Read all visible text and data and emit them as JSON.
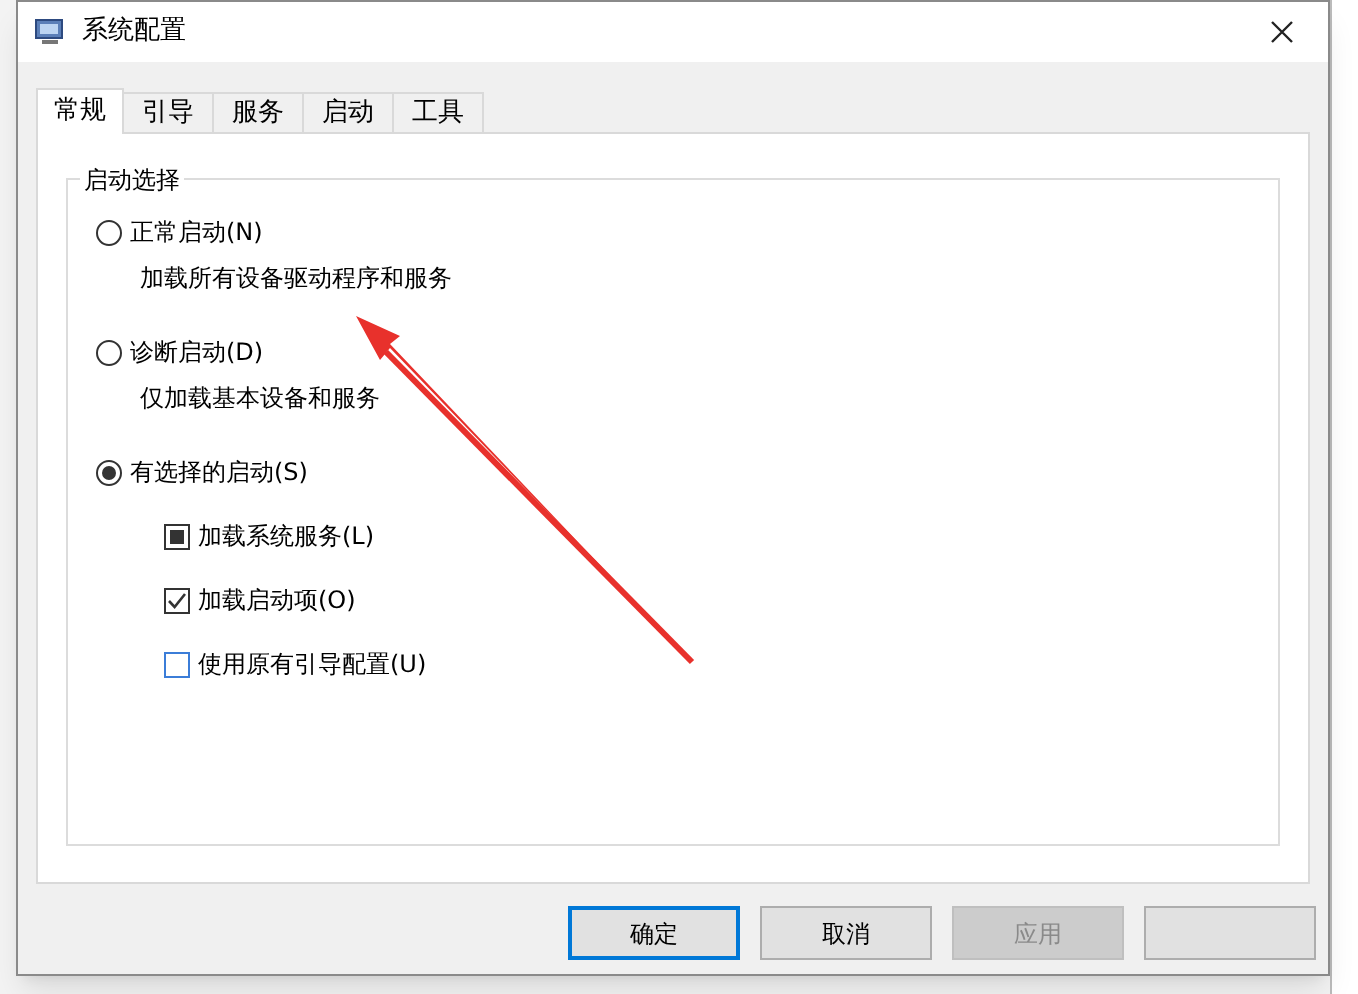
{
  "window": {
    "title": "系统配置"
  },
  "tabs": [
    {
      "label": "常规",
      "selected": true
    },
    {
      "label": "引导",
      "selected": false
    },
    {
      "label": "服务",
      "selected": false
    },
    {
      "label": "启动",
      "selected": false
    },
    {
      "label": "工具",
      "selected": false
    }
  ],
  "startup_group": {
    "legend": "启动选择",
    "options": [
      {
        "label": "正常启动(N)",
        "description": "加载所有设备驱动程序和服务",
        "selected": false
      },
      {
        "label": "诊断启动(D)",
        "description": "仅加载基本设备和服务",
        "selected": false
      },
      {
        "label": "有选择的启动(S)",
        "selected": true,
        "checkboxes": [
          {
            "label": "加载系统服务(L)",
            "checked": false,
            "indeterminate": true
          },
          {
            "label": "加载启动项(O)",
            "checked": true,
            "indeterminate": false
          },
          {
            "label": "使用原有引导配置(U)",
            "checked": false,
            "indeterminate": false
          }
        ]
      }
    ]
  },
  "buttons": [
    {
      "label": "确定",
      "default": true,
      "disabled": false
    },
    {
      "label": "取消",
      "default": false,
      "disabled": false
    },
    {
      "label": "应用",
      "default": false,
      "disabled": true
    }
  ]
}
